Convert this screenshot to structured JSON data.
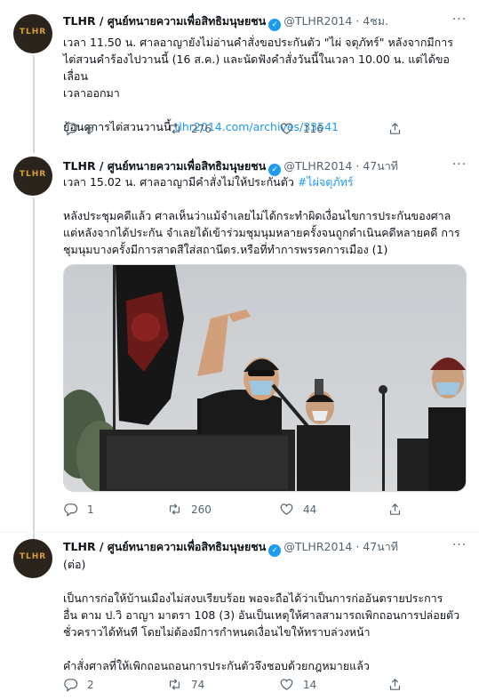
{
  "tweets": [
    {
      "author": "TLHR / ศูนย์ทนายความเพื่อสิทธิมนุษยชน",
      "handle": "@TLHR2014",
      "dot": "·",
      "time": "4ชม.",
      "avatar_text": "TLHR",
      "text_line1": "เวลา 11.50 น. ศาลอาญายังไม่อ่านคำสั่งขอประกันตัว \"ไผ่ จตุภัทร์\" หลังจากมีการ",
      "text_line2": "ไต่สวนคำร้องไปวานนี้ (16 ส.ค.) และนัดฟังคำสั่งวันนี้ในเวลา 10.00 น. แต่ได้ขอเลื่อน",
      "text_line3": "เวลาออกมา",
      "text_line4_prefix": "ย้อนดูการไต่สวนวานนี้ ",
      "text_link": "tlhr2014.com/archives/33541",
      "replies": "6",
      "retweets": "276",
      "likes": "116"
    },
    {
      "author": "TLHR / ศูนย์ทนายความเพื่อสิทธิมนุษยชน",
      "handle": "@TLHR2014",
      "dot": "·",
      "time": "47นาที",
      "avatar_text": "TLHR",
      "text_line1_prefix": "เวลา 15.02 น. ศาลอาญามีคำสั่งไม่ให้ประกันตัว ",
      "hashtag": "#ไผ่จตุภัทร์",
      "text_para2_line1": "หลังประชุมคดีแล้ว ศาลเห็นว่าแม้จำเลยไม่ได้กระทำผิดเงื่อนไขการประกันของศาล",
      "text_para2_line2": "แต่หลังจากได้ประกัน จำเลยได้เข้าร่วมชุมนุมหลายครั้งจนถูกดำเนินคดีหลายคดี การ",
      "text_para2_line3": "ชุมนุมบางครั้งมีการสาดสีใส่สถานีตร.หรือที่ทำการพรรคการเมือง (1)",
      "replies": "1",
      "retweets": "260",
      "likes": "44"
    },
    {
      "author": "TLHR / ศูนย์ทนายความเพื่อสิทธิมนุษยชน",
      "handle": "@TLHR2014",
      "dot": "·",
      "time": "47นาที",
      "avatar_text": "TLHR",
      "text_line1": "(ต่อ)",
      "text_para2_line1": "เป็นการก่อให้บ้านเมืองไม่สงบเรียบร้อย พอจะถือได้ว่าเป็นการก่ออันตรายประการ",
      "text_para2_line2": "อื่น ตาม ป.วิ อาญา มาตรา 108 (3) อันเป็นเหตุให้ศาลสามารถเพิกถอนการปล่อยตัว",
      "text_para2_line3": "ชั่วคราวได้ทันที โดยไม่ต้องมีการกำหนดเงื่อนไขให้ทราบล่วงหน้า",
      "text_para3": "คำสั่งศาลที่ให้เพิกถอนถอนการประกันตัวจึงชอบด้วยกฎหมายแล้ว",
      "replies": "2",
      "retweets": "74",
      "likes": "14"
    }
  ],
  "icons": {
    "verified": "✓",
    "more": "···"
  },
  "colors": {
    "accent": "#1d9bf0",
    "muted": "#536471",
    "text": "#0f1419",
    "divider": "#eff3f4",
    "thread_line": "#cfd9de",
    "avatar_bg": "#2b241c",
    "avatar_logo": "#d9a036"
  }
}
